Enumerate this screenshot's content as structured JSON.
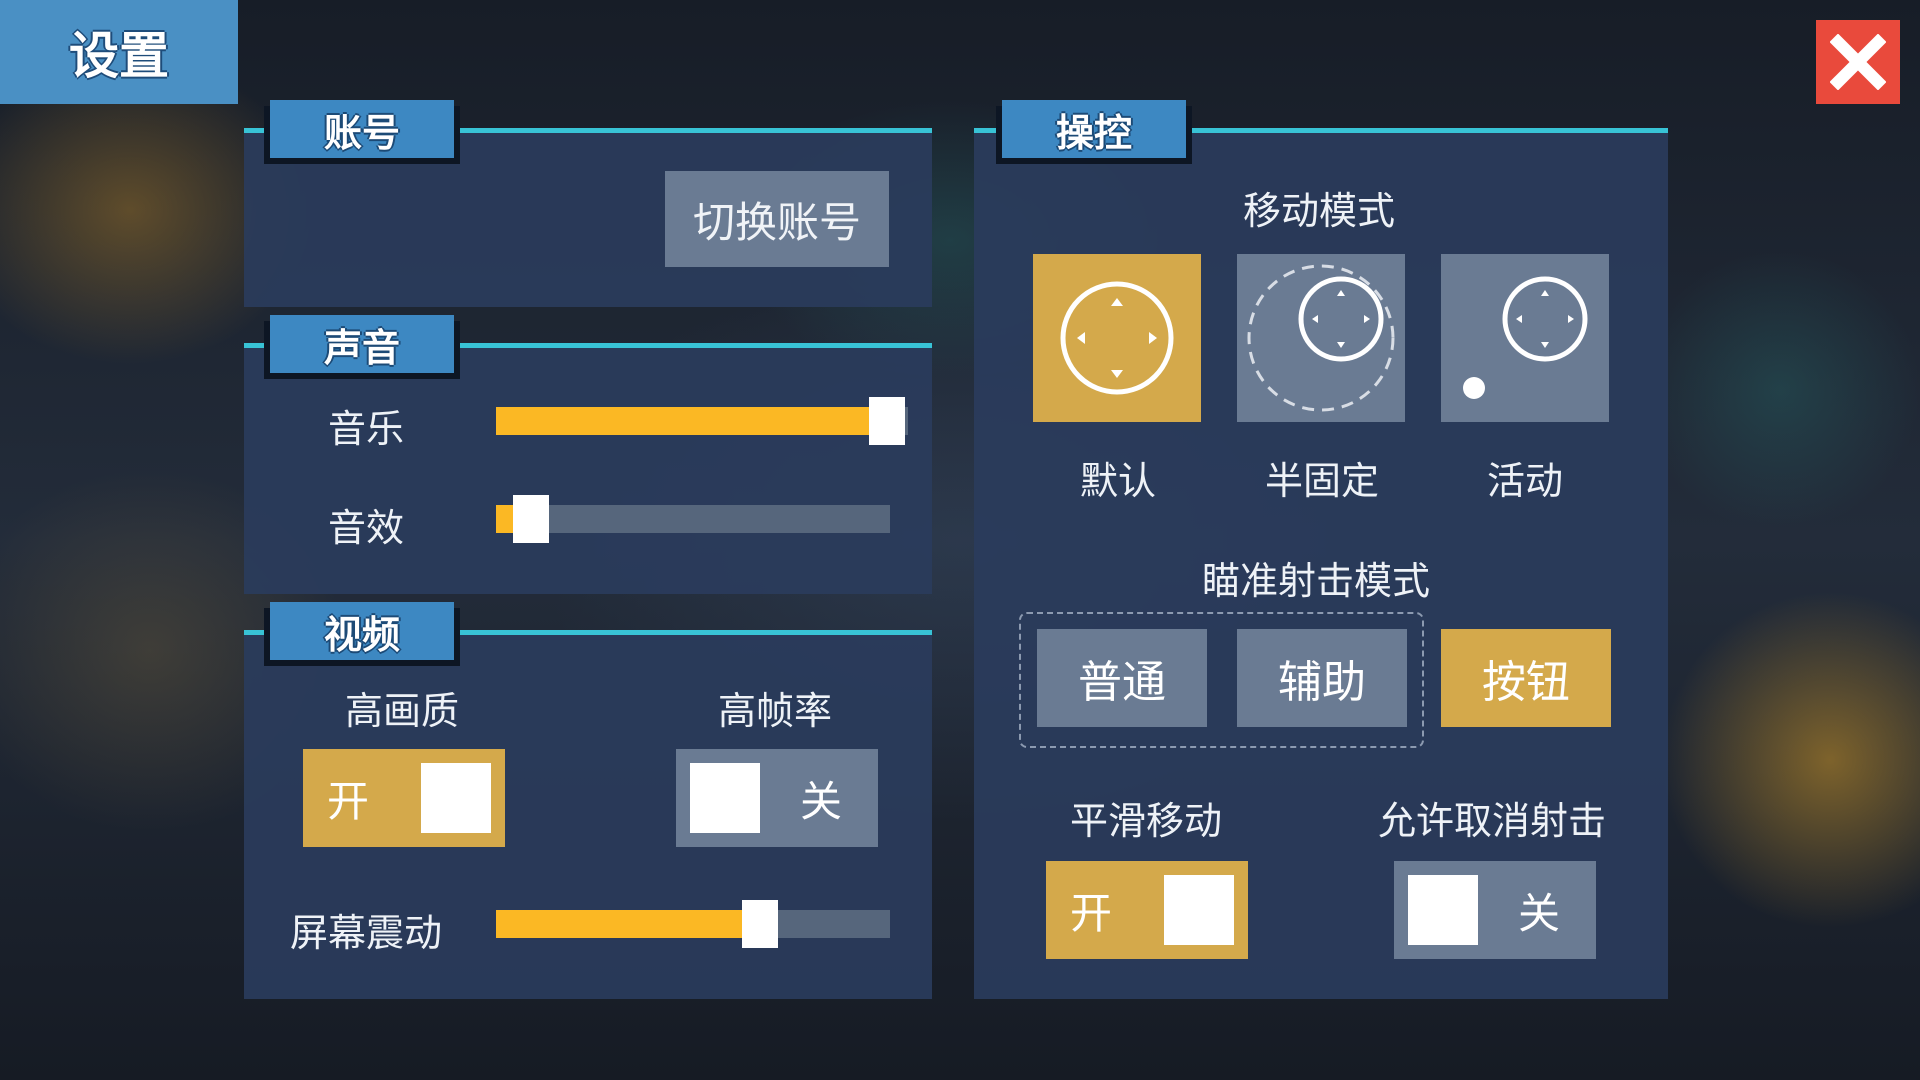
{
  "title": "设置",
  "close_icon": "close-icon",
  "account": {
    "tab": "账号",
    "switch_button": "切换账号"
  },
  "sound": {
    "tab": "声音",
    "music_label": "音乐",
    "music_level": 0.95,
    "sfx_label": "音效",
    "sfx_level": 0.09
  },
  "video": {
    "tab": "视频",
    "high_quality_label": "高画质",
    "high_quality_state": "开",
    "high_fps_label": "高帧率",
    "high_fps_state": "关",
    "screen_shake_label": "屏幕震动",
    "screen_shake_level": 0.67
  },
  "control": {
    "tab": "操控",
    "move_mode_label": "移动模式",
    "move_modes": [
      "默认",
      "半固定",
      "活动"
    ],
    "move_mode_selected": "默认",
    "aim_mode_label": "瞄准射击模式",
    "aim_modes": [
      "普通",
      "辅助",
      "按钮"
    ],
    "aim_mode_selected": "按钮",
    "smooth_move_label": "平滑移动",
    "smooth_move_state": "开",
    "allow_cancel_label": "允许取消射击",
    "allow_cancel_state": "关"
  },
  "colors": {
    "accent_gold": "#d4a94b",
    "slider_fill": "#fbb824",
    "tab_blue": "#3d88c2",
    "panel_line": "#38c3d6",
    "close_red": "#e94a3c"
  }
}
